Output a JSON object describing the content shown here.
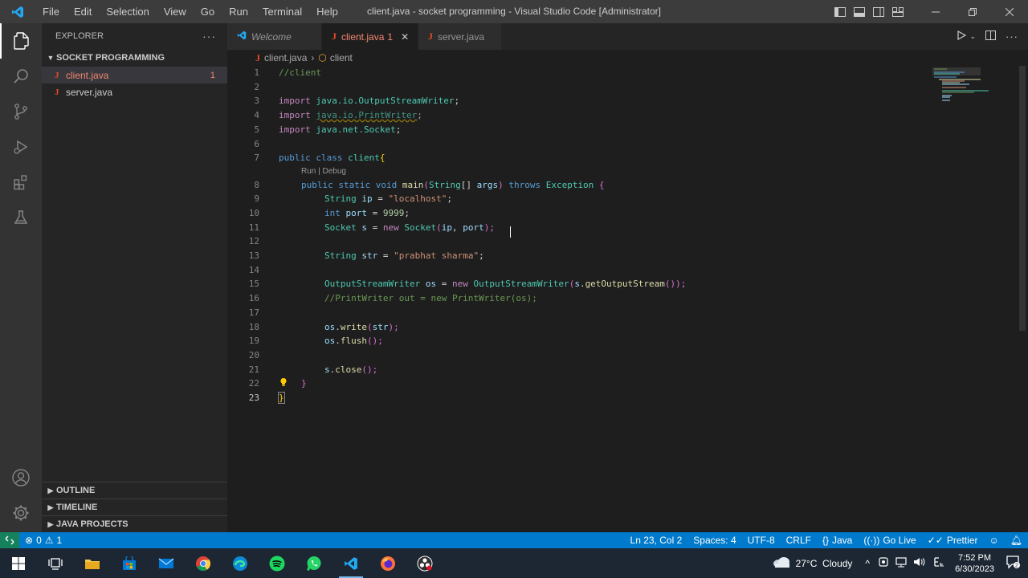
{
  "titlebar": {
    "menu": [
      "File",
      "Edit",
      "Selection",
      "View",
      "Go",
      "Run",
      "Terminal",
      "Help"
    ],
    "window_title": "client.java - socket programming - Visual Studio Code [Administrator]"
  },
  "sidebar": {
    "title": "EXPLORER",
    "more": "···",
    "folder": "SOCKET PROGRAMMING",
    "files": [
      {
        "name": "client.java",
        "icon": "J",
        "problems": "1"
      },
      {
        "name": "server.java",
        "icon": "J"
      }
    ],
    "panels": [
      "OUTLINE",
      "TIMELINE",
      "JAVA PROJECTS"
    ]
  },
  "tabs": [
    {
      "label": "Welcome",
      "icon": "vscode-icon"
    },
    {
      "label": "client.java",
      "badge": "1",
      "icon": "J"
    },
    {
      "label": "server.java",
      "icon": "J"
    }
  ],
  "breadcrumb": {
    "file": "client.java",
    "symbol": "client"
  },
  "editor": {
    "line_numbers": [
      "1",
      "2",
      "3",
      "4",
      "5",
      "6",
      "7",
      "8",
      "9",
      "10",
      "11",
      "12",
      "13",
      "14",
      "15",
      "16",
      "17",
      "18",
      "19",
      "20",
      "21",
      "22",
      "23"
    ],
    "codelens": "Run | Debug",
    "lines": {
      "l1": "//client",
      "l3a": "import ",
      "l3b": "java.io.OutputStreamWriter",
      "l3c": ";",
      "l4a": "import ",
      "l4b": "java.io.PrintWriter",
      "l4c": ";",
      "l5a": "import ",
      "l5b": "java.net.Socket",
      "l5c": ";",
      "l7a": "public class ",
      "l7b": "client",
      "l7c": "{",
      "l8a": "public static void ",
      "l8b": "main",
      "l8c": "(",
      "l8d": "String",
      "l8e": "[] ",
      "l8f": "args",
      "l8g": ") ",
      "l8h": "throws ",
      "l8i": "Exception",
      "l8j": " {",
      "l9a": "String ",
      "l9b": "ip",
      "l9c": " = ",
      "l9d": "\"localhost\"",
      "l9e": ";",
      "l10a": "int ",
      "l10b": "port",
      "l10c": " = ",
      "l10d": "9999",
      "l10e": ";",
      "l11a": "Socket ",
      "l11b": "s",
      "l11c": " = ",
      "l11d": "new ",
      "l11e": "Socket",
      "l11f": "(",
      "l11g": "ip",
      "l11h": ", ",
      "l11i": "port",
      "l11j": ");",
      "l13a": "String ",
      "l13b": "str",
      "l13c": " = ",
      "l13d": "\"prabhat sharma\"",
      "l13e": ";",
      "l15a": "OutputStreamWriter ",
      "l15b": "os",
      "l15c": " = ",
      "l15d": "new ",
      "l15e": "OutputStreamWriter",
      "l15f": "(",
      "l15g": "s",
      "l15h": ".",
      "l15i": "getOutputStream",
      "l15j": "());",
      "l16": "//PrintWriter out = new PrintWriter(os);",
      "l18a": "os",
      "l18b": ".",
      "l18c": "write",
      "l18d": "(",
      "l18e": "str",
      "l18f": ");",
      "l19a": "os",
      "l19b": ".",
      "l19c": "flush",
      "l19d": "();",
      "l21a": "s",
      "l21b": ".",
      "l21c": "close",
      "l21d": "();",
      "l22": "}",
      "l23": "}"
    }
  },
  "statusbar": {
    "errors": "0",
    "warnings": "1",
    "position": "Ln 23, Col 2",
    "spaces": "Spaces: 4",
    "encoding": "UTF-8",
    "eol": "CRLF",
    "language": "Java",
    "golive": "Go Live",
    "prettier": "Prettier"
  },
  "taskbar": {
    "weather": "27°C  Cloudy",
    "time": "7:52 PM",
    "date": "6/30/2023"
  },
  "colors": {
    "accent": "#007acc",
    "error": "#f48771",
    "java": "#e34c26"
  }
}
